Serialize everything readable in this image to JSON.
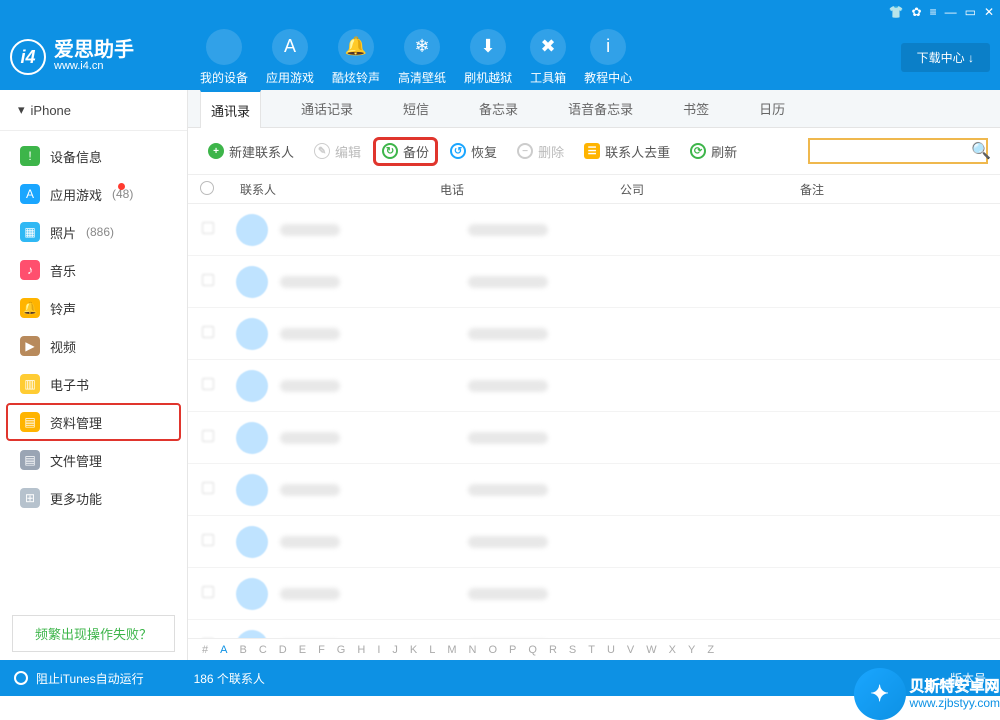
{
  "brand": {
    "name": "爱思助手",
    "url": "www.i4.cn"
  },
  "titlebar": {},
  "download_center": "下载中心 ↓",
  "top_nav": [
    {
      "label": "我的设备",
      "glyph": ""
    },
    {
      "label": "应用游戏",
      "glyph": "A"
    },
    {
      "label": "酷炫铃声",
      "glyph": "🔔"
    },
    {
      "label": "高清壁纸",
      "glyph": "❄"
    },
    {
      "label": "刷机越狱",
      "glyph": "⬇"
    },
    {
      "label": "工具箱",
      "glyph": "✖"
    },
    {
      "label": "教程中心",
      "glyph": "i"
    }
  ],
  "device_name": "iPhone",
  "sidebar": [
    {
      "label": "设备信息",
      "color": "#3db54a",
      "glyph": "!"
    },
    {
      "label": "应用游戏",
      "count": "(48)",
      "dot": true,
      "color": "#1aa6ff",
      "glyph": "A"
    },
    {
      "label": "照片",
      "count": "(886)",
      "color": "#30b8f4",
      "glyph": "▦"
    },
    {
      "label": "音乐",
      "color": "#ff4f6e",
      "glyph": "♪"
    },
    {
      "label": "铃声",
      "color": "#ffb400",
      "glyph": "🔔"
    },
    {
      "label": "视频",
      "color": "#b88a5c",
      "glyph": "▶"
    },
    {
      "label": "电子书",
      "color": "#ffcc33",
      "glyph": "▥"
    },
    {
      "label": "资料管理",
      "color": "#ffb400",
      "glyph": "▤",
      "active": true
    },
    {
      "label": "文件管理",
      "color": "#9aa5b4",
      "glyph": "▤"
    },
    {
      "label": "更多功能",
      "color": "#b6c2cd",
      "glyph": "⊞"
    }
  ],
  "faq_label": "频繁出现操作失败？",
  "subtabs": [
    "通讯录",
    "通话记录",
    "短信",
    "备忘录",
    "语音备忘录",
    "书签",
    "日历"
  ],
  "subtab_active": 0,
  "toolbar": {
    "new": "新建联系人",
    "edit": "编辑",
    "backup": "备份",
    "restore": "恢复",
    "delete": "删除",
    "dedupe": "联系人去重",
    "refresh": "刷新"
  },
  "columns": {
    "contact": "联系人",
    "phone": "电话",
    "company": "公司",
    "note": "备注"
  },
  "rows_count": 9,
  "alphabet": [
    "#",
    "A",
    "B",
    "C",
    "D",
    "E",
    "F",
    "G",
    "H",
    "I",
    "J",
    "K",
    "L",
    "M",
    "N",
    "O",
    "P",
    "Q",
    "R",
    "S",
    "T",
    "U",
    "V",
    "W",
    "X",
    "Y",
    "Z"
  ],
  "footer": {
    "left": "阻止iTunes自动运行",
    "mid": "186 个联系人",
    "right": "版本号"
  },
  "watermark": {
    "brand": "贝斯特安卓网",
    "url": "www.zjbstyy.com"
  }
}
